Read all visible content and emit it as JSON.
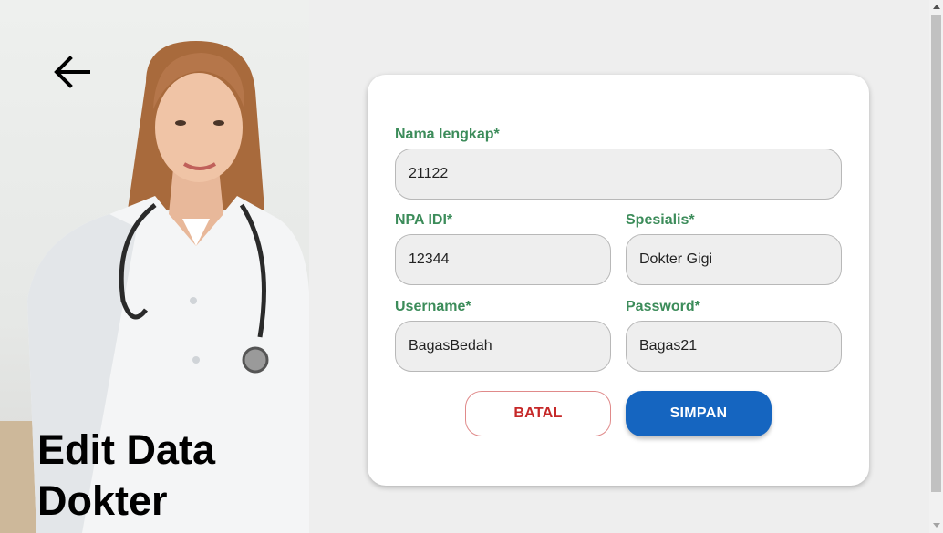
{
  "page": {
    "title_line1": "Edit Data",
    "title_line2": "Dokter"
  },
  "icons": {
    "back": "arrow-left-icon"
  },
  "form": {
    "nama_lengkap": {
      "label": "Nama lengkap*",
      "value": "21122"
    },
    "npa_idi": {
      "label": "NPA IDI*",
      "value": "12344"
    },
    "spesialis": {
      "label": "Spesialis*",
      "value": "Dokter Gigi"
    },
    "username": {
      "label": "Username*",
      "value": "BagasBedah"
    },
    "password": {
      "label": "Password*",
      "value": "Bagas21"
    }
  },
  "actions": {
    "cancel_label": "BATAL",
    "save_label": "SIMPAN"
  },
  "colors": {
    "label_green": "#3c8c5a",
    "save_blue": "#1565c0",
    "cancel_red": "#c62828"
  }
}
